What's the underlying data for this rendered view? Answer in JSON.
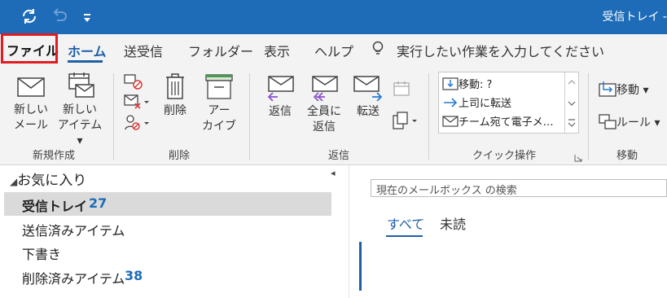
{
  "titlebar": {
    "title": "受信トレイ -",
    "bg_color": "#1e6cb8",
    "icons": [
      "sync-icon",
      "undo-icon",
      "customize-qat-icon"
    ]
  },
  "tabs": {
    "file": "ファイル",
    "home": "ホーム",
    "send_receive": "送受信",
    "folder": "フォルダー",
    "view": "表示",
    "help": "ヘルプ",
    "tell_me": "実行したい作業を入力してください"
  },
  "ribbon": {
    "new_email": [
      "新しい",
      "メール"
    ],
    "new_items": [
      "新しい",
      "アイテム ▾"
    ],
    "delete": "削除",
    "archive": [
      "アー",
      "カイブ"
    ],
    "reply": "返信",
    "reply_all": [
      "全員に",
      "返信"
    ],
    "forward": "転送",
    "quick_steps": [
      "移動: ?",
      "上司に転送",
      "チーム宛て電子メ…"
    ],
    "move": "移動 ▾",
    "rules": "ルール ▾",
    "groups": {
      "new": "新規作成",
      "delete": "削除",
      "respond": "返信",
      "quick_steps": "クイック操作",
      "move": "移動"
    }
  },
  "navigation": {
    "favorites": "お気に入り",
    "folders": [
      {
        "name": "受信トレイ",
        "count": "27",
        "selected": true
      },
      {
        "name": "送信済みアイテム",
        "count": ""
      },
      {
        "name": "下書き",
        "count": ""
      },
      {
        "name": "削除済みアイテム",
        "count": "38"
      }
    ]
  },
  "mail_list": {
    "search_placeholder": "現在のメールボックス の検索",
    "filters": {
      "all": "すべて",
      "unread": "未読"
    },
    "accent_color": "#1e5fa8"
  },
  "highlight_color": "#e21b23"
}
